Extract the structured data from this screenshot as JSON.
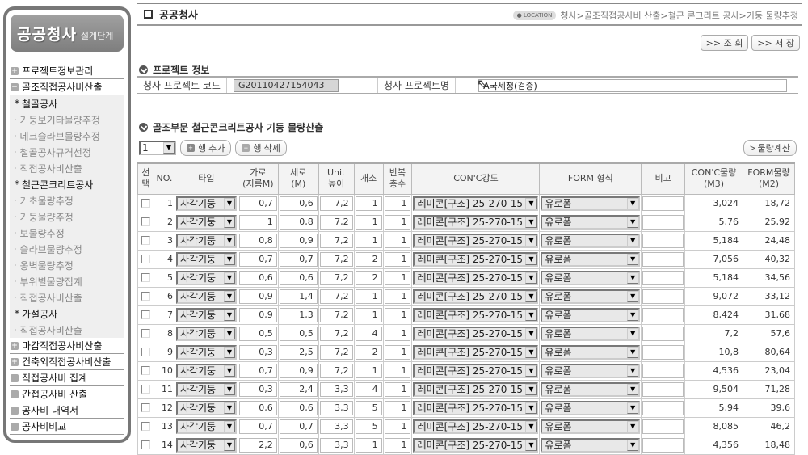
{
  "sidebar": {
    "brand": "공공청사",
    "brand_sub": "설계단계",
    "items": [
      {
        "label": "프로젝트정보관리",
        "icon": "plus"
      },
      {
        "label": "골조직접공사비산출",
        "icon": "minus"
      }
    ],
    "submenu": [
      {
        "type": "head",
        "label": "철골공사"
      },
      {
        "type": "item",
        "label": "기둥보기타물량추정"
      },
      {
        "type": "item",
        "label": "데크슬라브물량추정"
      },
      {
        "type": "item",
        "label": "철골공사규격선정"
      },
      {
        "type": "item",
        "label": "직접공사비산출"
      },
      {
        "type": "head",
        "label": "철근콘크리트공사"
      },
      {
        "type": "item",
        "label": "기초물량추정"
      },
      {
        "type": "item",
        "label": "기둥물량추정"
      },
      {
        "type": "item",
        "label": "보물량추정"
      },
      {
        "type": "item",
        "label": "슬라브물량추정"
      },
      {
        "type": "item",
        "label": "옹벽물량추정"
      },
      {
        "type": "item",
        "label": "부위별물량집계"
      },
      {
        "type": "item",
        "label": "직접공사비산출"
      },
      {
        "type": "head",
        "label": "가설공사"
      },
      {
        "type": "item",
        "label": "직접공사비산출"
      }
    ],
    "items_after": [
      {
        "label": "마감직접공사비산출",
        "icon": "plus"
      },
      {
        "label": "건축외직접공사비산출",
        "icon": "plus"
      },
      {
        "label": "직접공사비 집계",
        "icon": "square"
      },
      {
        "label": "간접공사비 산출",
        "icon": "square"
      },
      {
        "label": "공사비 내역서",
        "icon": "square"
      },
      {
        "label": "공사비비교",
        "icon": "square"
      }
    ]
  },
  "header": {
    "title": "공공청사",
    "location_badge": "LOCATION",
    "breadcrumb": "청사>골조직접공사비 산출>철근 콘크리트 공사>기둥 물량추정",
    "search_button": ">> 조 회",
    "save_button": ">> 저 장"
  },
  "project_info": {
    "section_title": "프로젝트 정보",
    "code_label": "청사 프로젝트 코드",
    "code_value": "G20110427154043",
    "name_label": "청사 프로젝트명",
    "name_value": "A국세청(검증)"
  },
  "quantity": {
    "section_title": "골조부문 철근콘크리트공사 기둥 물량산출",
    "row_count_select": "1",
    "add_row_button": "행 추가",
    "delete_row_button": "행 삭제",
    "calc_button": "> 물량계산",
    "columns": [
      "선\n택",
      "NO.",
      "타입",
      "가로\n(지름M)",
      "세로\n(M)",
      "Unit\n높이",
      "개소",
      "반복\n층수",
      "CON'C강도",
      "FORM 형식",
      "비고",
      "CON'C물량\n(M3)",
      "FORM물량\n(M2)"
    ],
    "rows": [
      {
        "no": "1",
        "type": "사각기둥",
        "w": "0,7",
        "h": "0,6",
        "unit_h": "7,2",
        "count": "1",
        "floors": "1",
        "strength": "레미콘[구조] 25-270-15",
        "form": "유로폼",
        "note": "",
        "conc": "3,024",
        "form_qty": "18,72"
      },
      {
        "no": "2",
        "type": "사각기둥",
        "w": "1",
        "h": "0,8",
        "unit_h": "7,2",
        "count": "1",
        "floors": "1",
        "strength": "레미콘[구조] 25-270-15",
        "form": "유로폼",
        "note": "",
        "conc": "5,76",
        "form_qty": "25,92"
      },
      {
        "no": "3",
        "type": "사각기둥",
        "w": "0,8",
        "h": "0,9",
        "unit_h": "7,2",
        "count": "1",
        "floors": "1",
        "strength": "레미콘[구조] 25-270-15",
        "form": "유로폼",
        "note": "",
        "conc": "5,184",
        "form_qty": "24,48"
      },
      {
        "no": "4",
        "type": "사각기둥",
        "w": "0,7",
        "h": "0,7",
        "unit_h": "7,2",
        "count": "2",
        "floors": "1",
        "strength": "레미콘[구조] 25-270-15",
        "form": "유로폼",
        "note": "",
        "conc": "7,056",
        "form_qty": "40,32"
      },
      {
        "no": "5",
        "type": "사각기둥",
        "w": "0,6",
        "h": "0,6",
        "unit_h": "7,2",
        "count": "2",
        "floors": "1",
        "strength": "레미콘[구조] 25-270-15",
        "form": "유로폼",
        "note": "",
        "conc": "5,184",
        "form_qty": "34,56"
      },
      {
        "no": "6",
        "type": "사각기둥",
        "w": "0,9",
        "h": "1,4",
        "unit_h": "7,2",
        "count": "1",
        "floors": "1",
        "strength": "레미콘[구조] 25-270-15",
        "form": "유로폼",
        "note": "",
        "conc": "9,072",
        "form_qty": "33,12"
      },
      {
        "no": "7",
        "type": "사각기둥",
        "w": "0,9",
        "h": "1,3",
        "unit_h": "7,2",
        "count": "1",
        "floors": "1",
        "strength": "레미콘[구조] 25-270-15",
        "form": "유로폼",
        "note": "",
        "conc": "8,424",
        "form_qty": "31,68"
      },
      {
        "no": "8",
        "type": "사각기둥",
        "w": "0,5",
        "h": "0,5",
        "unit_h": "7,2",
        "count": "4",
        "floors": "1",
        "strength": "레미콘[구조] 25-270-15",
        "form": "유로폼",
        "note": "",
        "conc": "7,2",
        "form_qty": "57,6"
      },
      {
        "no": "9",
        "type": "사각기둥",
        "w": "0,3",
        "h": "2,5",
        "unit_h": "7,2",
        "count": "2",
        "floors": "1",
        "strength": "레미콘[구조] 25-270-15",
        "form": "유로폼",
        "note": "",
        "conc": "10,8",
        "form_qty": "80,64"
      },
      {
        "no": "10",
        "type": "사각기둥",
        "w": "0,7",
        "h": "0,9",
        "unit_h": "7,2",
        "count": "1",
        "floors": "1",
        "strength": "레미콘[구조] 25-270-15",
        "form": "유로폼",
        "note": "",
        "conc": "4,536",
        "form_qty": "23,04"
      },
      {
        "no": "11",
        "type": "사각기둥",
        "w": "0,3",
        "h": "2,4",
        "unit_h": "3,3",
        "count": "4",
        "floors": "1",
        "strength": "레미콘[구조] 25-270-15",
        "form": "유로폼",
        "note": "",
        "conc": "9,504",
        "form_qty": "71,28"
      },
      {
        "no": "12",
        "type": "사각기둥",
        "w": "0,6",
        "h": "0,6",
        "unit_h": "3,3",
        "count": "5",
        "floors": "1",
        "strength": "레미콘[구조] 25-270-15",
        "form": "유로폼",
        "note": "",
        "conc": "5,94",
        "form_qty": "39,6"
      },
      {
        "no": "13",
        "type": "사각기둥",
        "w": "0,7",
        "h": "0,7",
        "unit_h": "3,3",
        "count": "5",
        "floors": "1",
        "strength": "레미콘[구조] 25-270-15",
        "form": "유로폼",
        "note": "",
        "conc": "8,085",
        "form_qty": "46,2"
      },
      {
        "no": "14",
        "type": "사각기둥",
        "w": "2,2",
        "h": "0,6",
        "unit_h": "3,3",
        "count": "1",
        "floors": "1",
        "strength": "레미콘[구조] 25-270-15",
        "form": "유로폼",
        "note": "",
        "conc": "4,356",
        "form_qty": "18,48"
      }
    ]
  }
}
